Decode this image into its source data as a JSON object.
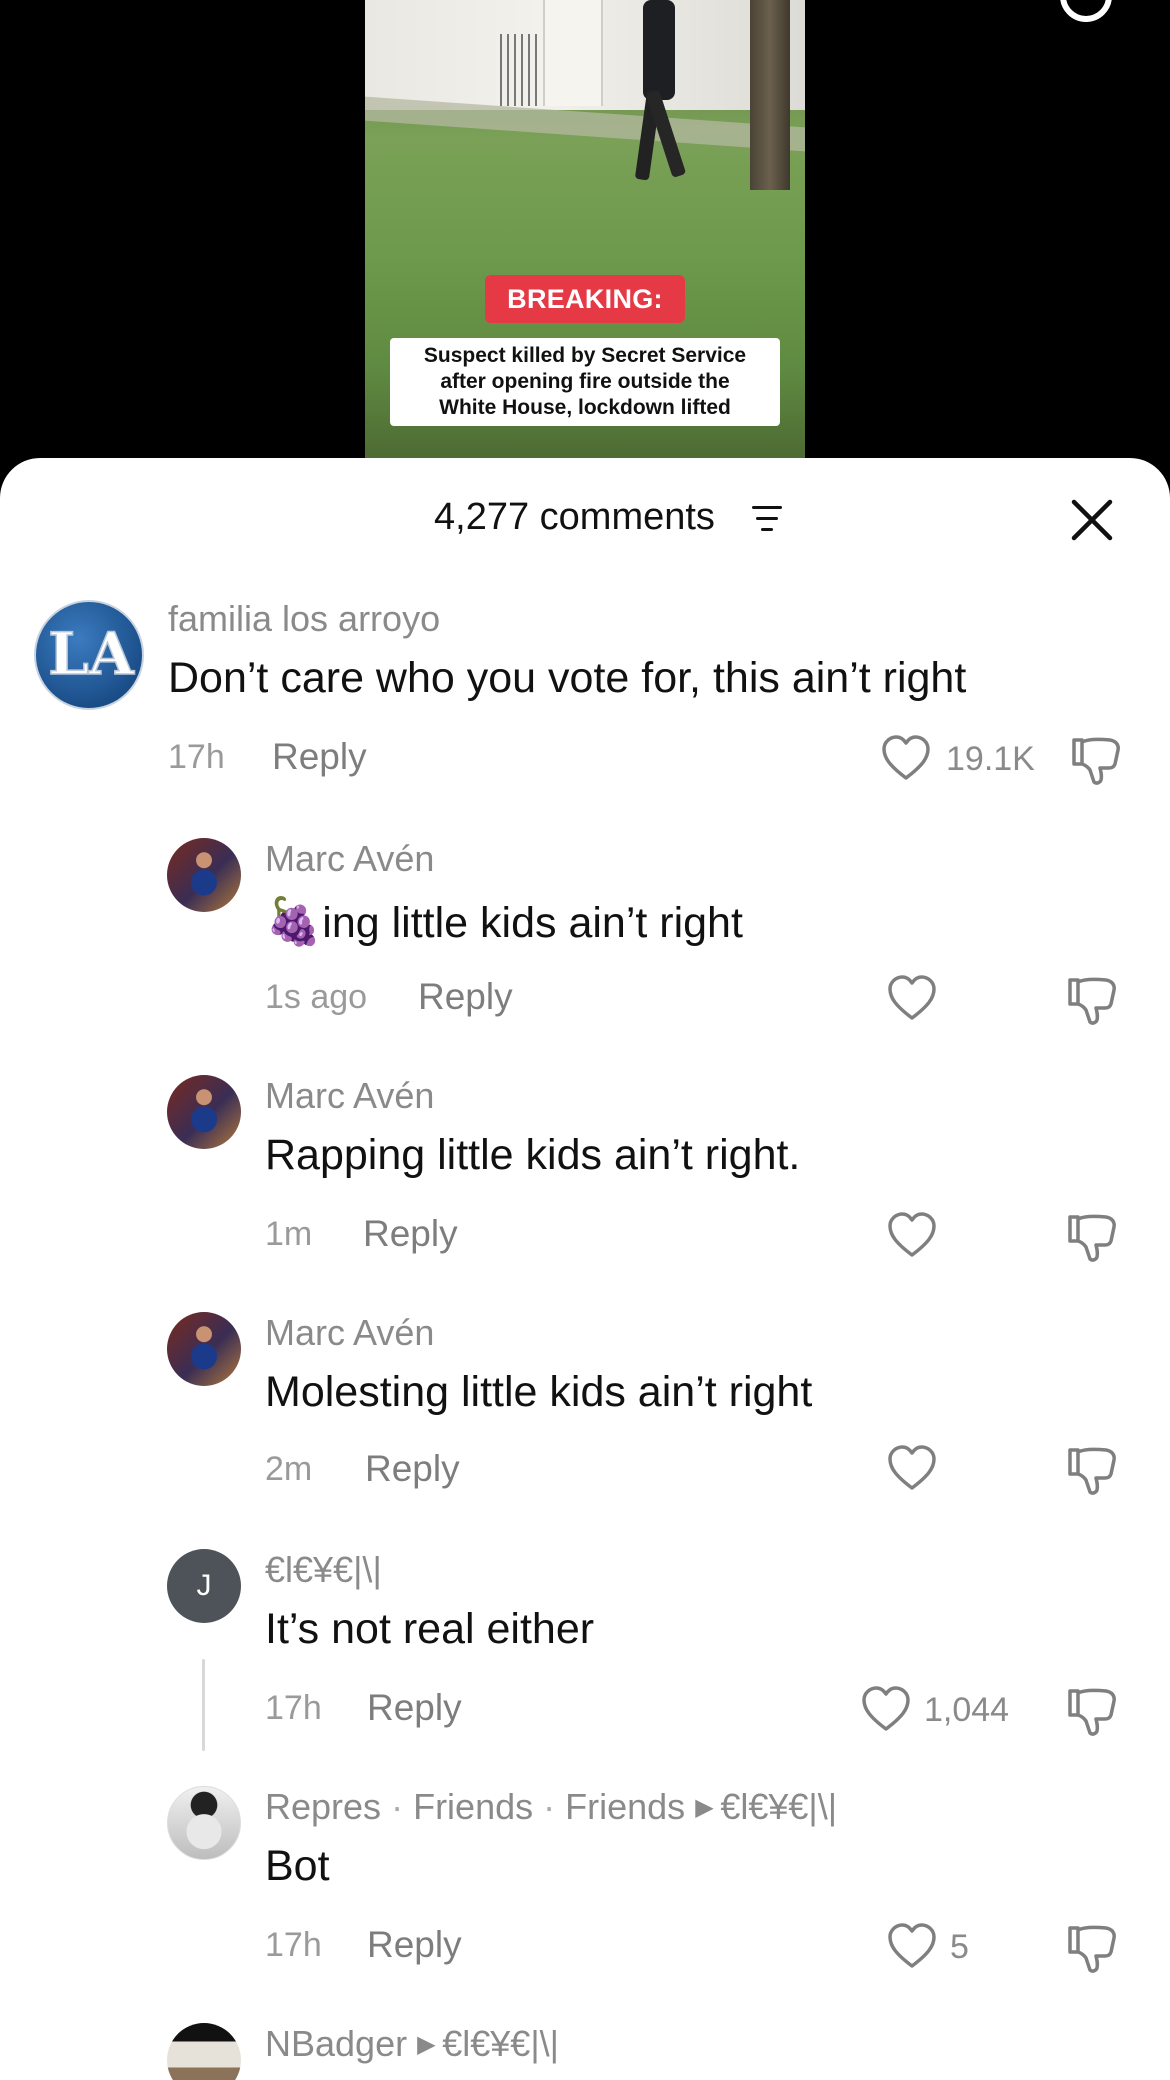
{
  "video": {
    "badge": "BREAKING:",
    "headline_lines": [
      "Suspect killed by Secret Service",
      "after opening fire outside the",
      "White House, lockdown lifted"
    ]
  },
  "sheet": {
    "count_label": "4,277 comments",
    "filter_icon": "sort-filter-icon",
    "close_icon": "close-icon"
  },
  "comments": [
    {
      "username": "familia los arroyo",
      "text": "Don’t care who you vote for, this ain’t right",
      "time": "17h",
      "reply": "Reply",
      "likes": "19.1K"
    },
    {
      "username": "Marc Avén",
      "emoji": "🍇",
      "text": "ing little kids ain’t right",
      "time": "1s ago",
      "reply": "Reply",
      "likes": ""
    },
    {
      "username": "Marc Avén",
      "text": "Rapping little kids ain’t right.",
      "time": "1m",
      "reply": "Reply",
      "likes": ""
    },
    {
      "username": "Marc Avén",
      "text": "Molesting little kids ain’t right",
      "time": "2m",
      "reply": "Reply",
      "likes": ""
    },
    {
      "avatar_letter": "J",
      "username": "€l€¥€|\\|",
      "text": "It’s not real either",
      "time": "17h",
      "reply": "Reply",
      "likes": "1,044"
    },
    {
      "username": "Repres",
      "tag1": "Friends",
      "tag2": "Friends",
      "reply_to": "€l€¥€|\\|",
      "text": "Bot",
      "time": "17h",
      "reply": "Reply",
      "likes": "5"
    },
    {
      "username": "NBadger",
      "reply_to": "€l€¥€|\\|"
    }
  ]
}
